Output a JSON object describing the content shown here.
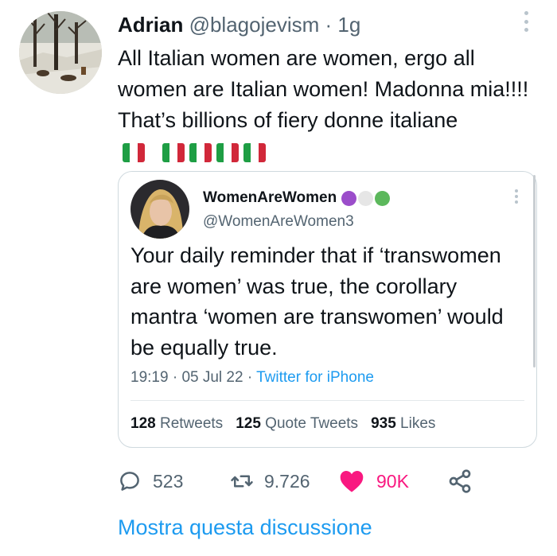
{
  "tweet": {
    "author_name": "Adrian",
    "author_handle": "@blagojevism",
    "separator": "·",
    "time": "1g",
    "text": "All Italian women are women, ergo all women are Italian women! Madonna mia!!!! That’s billions of fiery donne italiane",
    "avatar_icon": "winter-painting-avatar"
  },
  "quoted": {
    "author_name": "WomenAreWomen",
    "author_handle": "@WomenAreWomen3",
    "badge_colors": [
      "#9b4dca",
      "#e6e6e6",
      "#5cb85c"
    ],
    "text": "Your daily reminder that if ‘transwomen are women’ was true, the corollary mantra ‘women are transwomen’ would be equally true.",
    "time": "19:19",
    "separator": "·",
    "date": "05 Jul 22",
    "source": "Twitter for iPhone",
    "stats": {
      "retweets_count": "128",
      "retweets_label": "Retweets",
      "quotes_count": "125",
      "quotes_label": "Quote Tweets",
      "likes_count": "935",
      "likes_label": "Likes"
    }
  },
  "actions": {
    "replies": "523",
    "retweets": "9.726",
    "likes": "90K"
  },
  "thread_link": "Mostra questa discussione",
  "colors": {
    "accent": "#1d9bf0",
    "like": "#f91880",
    "muted": "#536471"
  }
}
